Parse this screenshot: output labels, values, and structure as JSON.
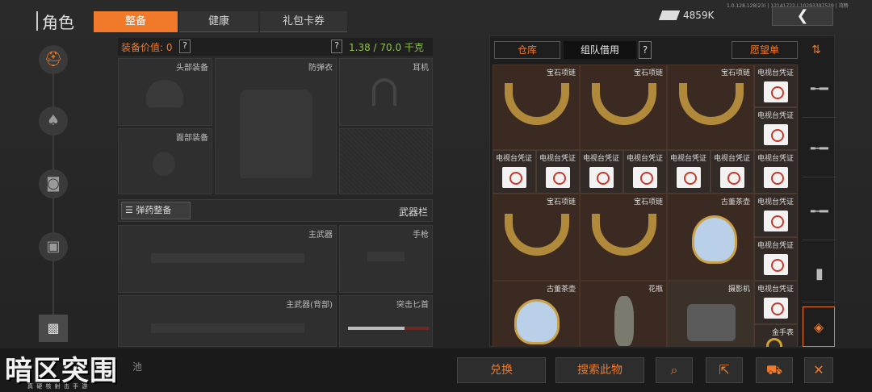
{
  "header": {
    "title": "角色",
    "tabs": [
      "整备",
      "健康",
      "礼包卡券"
    ],
    "currency": "4859K",
    "version_text": "1.0.128.128(23) | 12141722 | 10293397529 | 流畅"
  },
  "loadout": {
    "value_label": "装备价值: 0",
    "help": "?",
    "weight_help": "?",
    "weight": "1.38 / 70.0 千克",
    "slots": {
      "head": "头部装备",
      "armor": "防弹衣",
      "headset": "耳机",
      "face": "面部装备",
      "primary": "主武器",
      "pistol": "手枪",
      "primary_back": "主武器(背部)",
      "melee": "突击匕首"
    },
    "ammo_button": "弹药整备",
    "weapons_label": "武器栏"
  },
  "storage": {
    "tabs": [
      "仓库",
      "组队借用"
    ],
    "help": "?",
    "wishlist": "愿望单",
    "items": {
      "necklace": "宝石项链",
      "tv_cert": "电视台凭证",
      "teapot": "古董茶壶",
      "vase": "花瓶",
      "camera": "摄影机",
      "gold_watch": "金手表"
    }
  },
  "footer": {
    "exchange": "兑换",
    "search_item": "搜索此物",
    "logo": "暗区突围",
    "logo_sub": "真 硬 核 射 击 手 游",
    "left_partial": "池"
  },
  "colors": {
    "accent": "#f07a2a",
    "weight": "#8fc24a",
    "value": "#f07a2a"
  }
}
